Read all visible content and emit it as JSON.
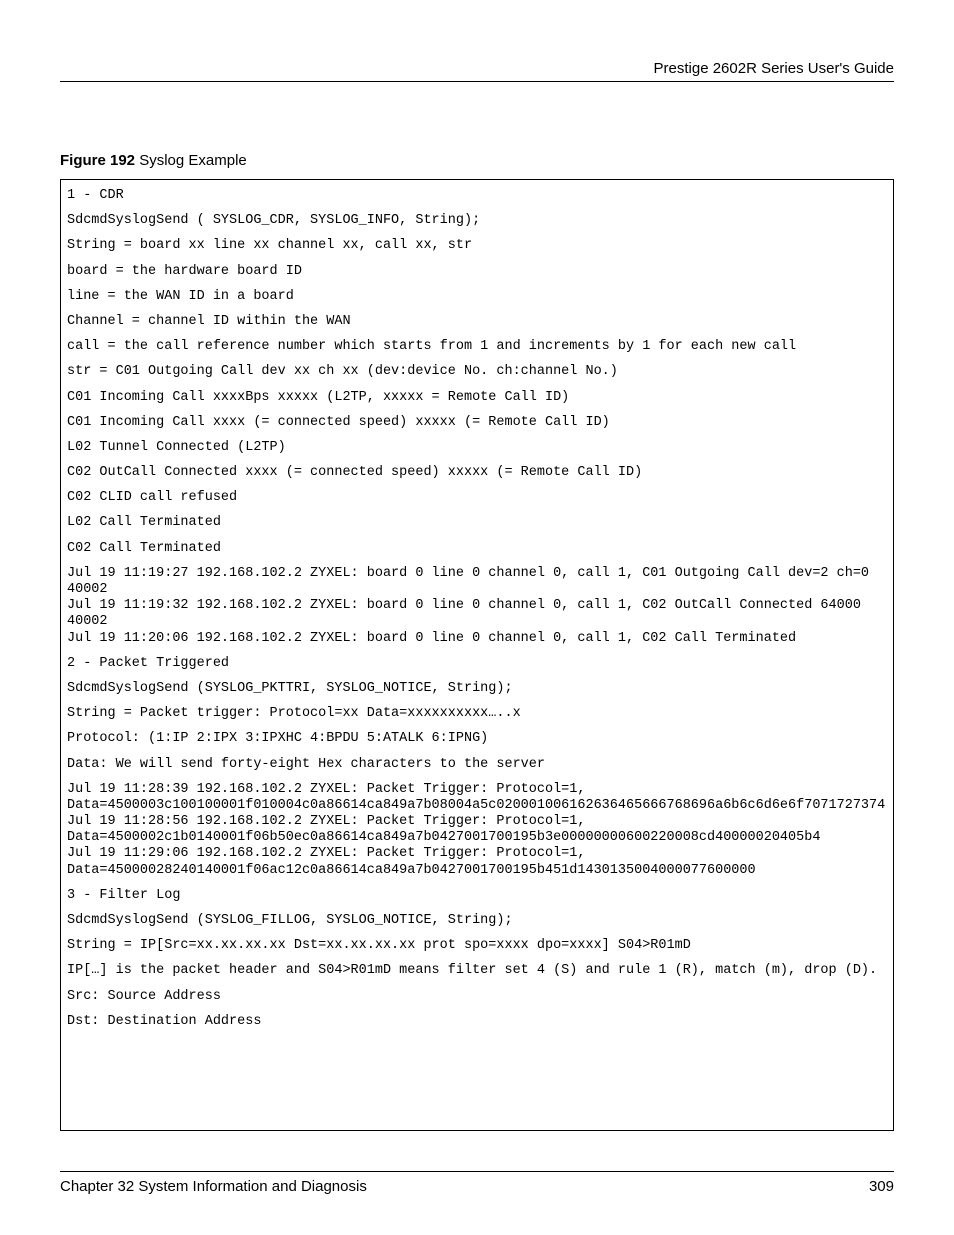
{
  "header_title": "Prestige 2602R Series User's Guide",
  "figure_label_bold": "Figure 192",
  "figure_label_rest": "   Syslog Example",
  "code_lines": [
    "1 - CDR",
    "SdcmdSyslogSend ( SYSLOG_CDR, SYSLOG_INFO, String);",
    "String = board xx line xx channel xx, call xx, str",
    "board = the hardware board ID",
    "line = the WAN ID in a board",
    "Channel = channel ID within the WAN",
    "call = the call reference number which starts from 1 and increments by 1 for each new call",
    "str = C01 Outgoing Call dev xx ch xx (dev:device No. ch:channel No.)",
    "C01 Incoming Call xxxxBps xxxxx (L2TP, xxxxx = Remote Call ID)",
    "C01 Incoming Call xxxx (= connected speed) xxxxx (= Remote Call ID)",
    "L02 Tunnel Connected (L2TP)",
    "C02 OutCall Connected xxxx (= connected speed) xxxxx (= Remote Call ID)",
    "C02 CLID call refused",
    "L02 Call Terminated",
    "C02 Call Terminated",
    "Jul 19 11:19:27 192.168.102.2 ZYXEL: board 0 line 0 channel 0, call 1, C01 Outgoing Call dev=2 ch=0 40002\nJul 19 11:19:32 192.168.102.2 ZYXEL: board 0 line 0 channel 0, call 1, C02 OutCall Connected 64000 40002\nJul 19 11:20:06 192.168.102.2 ZYXEL: board 0 line 0 channel 0, call 1, C02 Call Terminated",
    "2 - Packet Triggered",
    "SdcmdSyslogSend (SYSLOG_PKTTRI, SYSLOG_NOTICE, String);",
    "String = Packet trigger: Protocol=xx Data=xxxxxxxxxx…..x",
    "Protocol: (1:IP 2:IPX 3:IPXHC 4:BPDU 5:ATALK 6:IPNG)",
    "Data: We will send forty-eight Hex characters to the server",
    "Jul 19 11:28:39 192.168.102.2 ZYXEL: Packet Trigger: Protocol=1, Data=4500003c100100001f010004c0a86614ca849a7b08004a5c020001006162636465666768696a6b6c6d6e6f7071727374\nJul 19 11:28:56 192.168.102.2 ZYXEL: Packet Trigger: Protocol=1, Data=4500002c1b0140001f06b50ec0a86614ca849a7b0427001700195b3e00000000600220008cd40000020405b4\nJul 19 11:29:06 192.168.102.2 ZYXEL: Packet Trigger: Protocol=1, Data=45000028240140001f06ac12c0a86614ca849a7b0427001700195b451d1430135004000077600000",
    "3 - Filter Log",
    "SdcmdSyslogSend (SYSLOG_FILLOG, SYSLOG_NOTICE, String);",
    "String = IP[Src=xx.xx.xx.xx Dst=xx.xx.xx.xx prot spo=xxxx dpo=xxxx] S04>R01mD",
    "IP[…] is the packet header and S04>R01mD means filter set 4 (S) and rule 1 (R), match (m), drop (D).",
    "Src: Source Address",
    "Dst: Destination Address"
  ],
  "footer_chapter": "Chapter 32 System Information and Diagnosis",
  "footer_page": "309"
}
